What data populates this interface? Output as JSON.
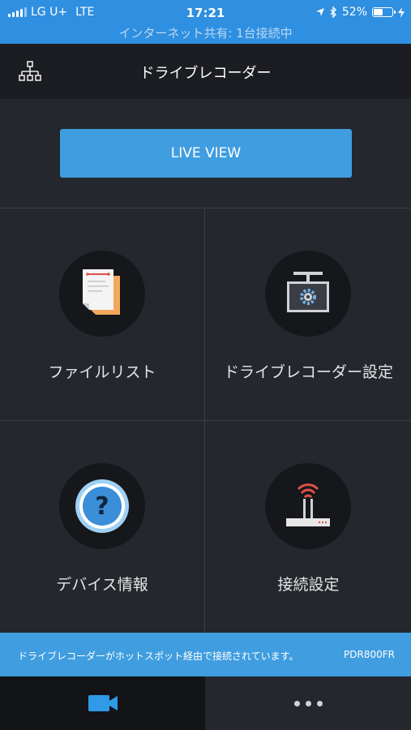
{
  "status_bar": {
    "carrier": "LG U+",
    "network": "LTE",
    "time": "17:21",
    "battery": "52%",
    "battery_level": 0.52,
    "hotspot_text": "インターネット共有: 1台接続中"
  },
  "nav": {
    "title": "ドライブレコーダー",
    "left_icon": "network-tree-icon"
  },
  "live_view": {
    "label": "LIVE VIEW"
  },
  "tiles": [
    {
      "label": "ファイルリスト",
      "icon": "file-list-icon"
    },
    {
      "label": "ドライブレコーダー設定",
      "icon": "recorder-settings-icon"
    },
    {
      "label": "デバイス情報",
      "icon": "help-question-icon"
    },
    {
      "label": "接続設定",
      "icon": "wifi-router-icon"
    }
  ],
  "footer": {
    "message": "ドライブレコーダーがホットスポット経由で接続されています。",
    "model": "PDR800FR"
  },
  "tabs": [
    {
      "icon": "video-camera-icon"
    },
    {
      "icon": "more-dots-icon"
    }
  ],
  "colors": {
    "accent": "#3f9de0",
    "status_bar": "#2f8fe0",
    "background": "#24272d",
    "nav_bg": "#1b1d22"
  }
}
